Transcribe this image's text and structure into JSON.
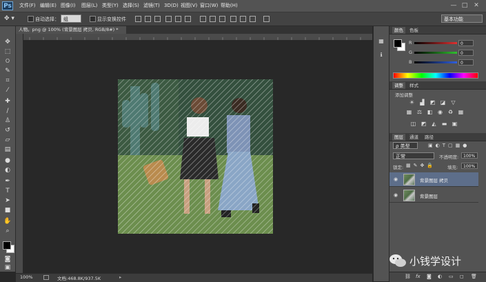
{
  "app": {
    "logo": "Ps"
  },
  "menu": [
    "文件(F)",
    "编辑(E)",
    "图像(I)",
    "图层(L)",
    "类型(Y)",
    "选择(S)",
    "滤镜(T)",
    "3D(D)",
    "视图(V)",
    "窗口(W)",
    "帮助(H)"
  ],
  "window_controls": {
    "minimize": "—",
    "maximize": "□",
    "close": "✕"
  },
  "options": {
    "auto_select_label": "自动选择：",
    "auto_select_value": "组",
    "show_transform_label": "显示变换控件",
    "workspace": "基本功能"
  },
  "document": {
    "tab_title": "人物。png @ 100% (背景图层 拷贝, RGB/8#) *",
    "zoom": "100%",
    "doc_info": "文档:468.8K/937.5K"
  },
  "ruler_labels": [
    "1",
    "0",
    "1",
    "2",
    "3",
    "4",
    "5",
    "6",
    "7",
    "8",
    "9",
    "10",
    "11",
    "12",
    "13",
    "14",
    "15",
    "16",
    "17",
    "18",
    "19",
    "20",
    "21",
    "22",
    "23"
  ],
  "color_panel": {
    "tabs": [
      "颜色",
      "色板"
    ],
    "channels": [
      {
        "label": "R",
        "value": "0",
        "color": "#e03030"
      },
      {
        "label": "G",
        "value": "0",
        "color": "#30c030"
      },
      {
        "label": "B",
        "value": "0",
        "color": "#3060e0"
      }
    ]
  },
  "adjustments_panel": {
    "tabs": [
      "调整",
      "样式"
    ],
    "title": "添加调整"
  },
  "layers_panel": {
    "tabs": [
      "图层",
      "通道",
      "路径"
    ],
    "filter_kind": "ρ 类型",
    "blend_mode": "正常",
    "opacity_label": "不透明度:",
    "opacity_value": "100%",
    "lock_label": "锁定:",
    "fill_label": "填充:",
    "fill_value": "100%",
    "layers": [
      {
        "name": "背景图层 拷贝",
        "selected": true
      },
      {
        "name": "背景图层",
        "selected": false
      }
    ],
    "footer_icons": [
      "link-icon",
      "fx-icon",
      "mask-icon",
      "adjustment-icon",
      "folder-icon",
      "new-layer-icon",
      "trash-icon"
    ]
  },
  "watermark": {
    "text": "小钱学设计"
  },
  "colors": {
    "accent": "#5d6e8a",
    "foreground": "#000000",
    "background": "#ffffff"
  }
}
